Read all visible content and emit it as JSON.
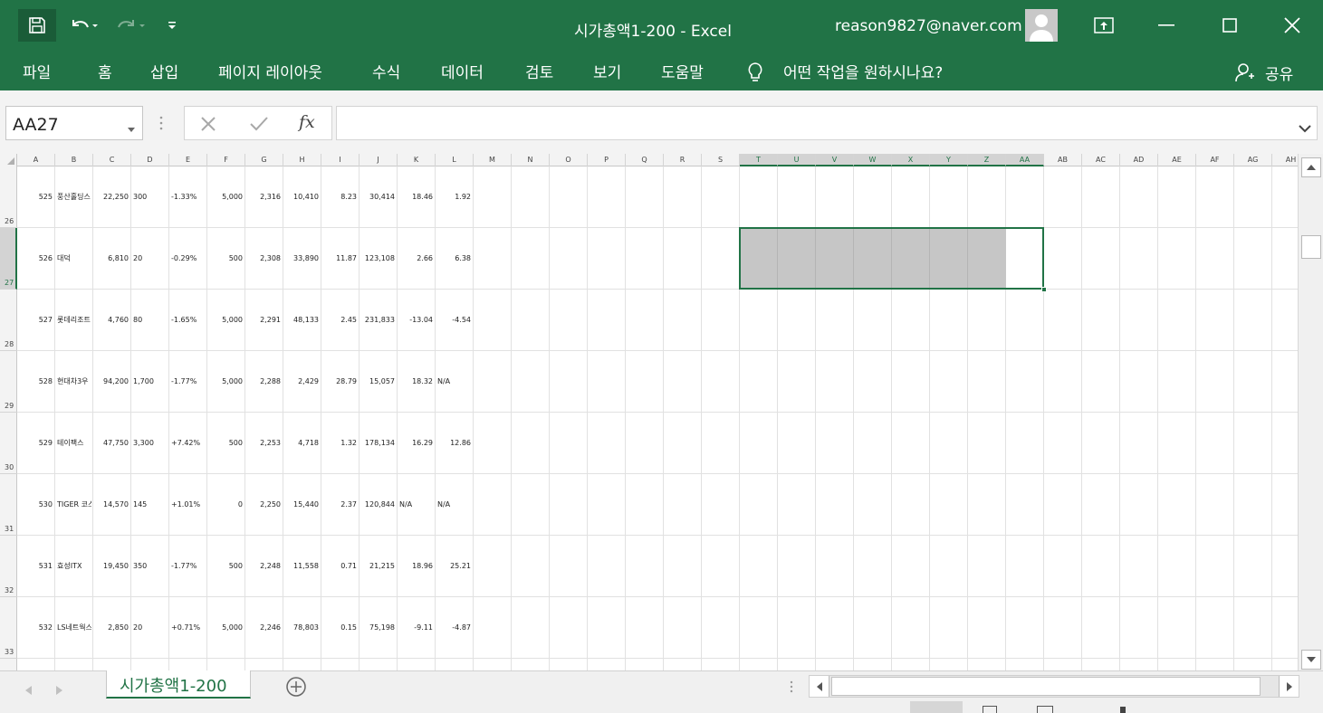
{
  "window": {
    "title": "시가총액1-200  -  Excel",
    "account": "reason9827@naver.com"
  },
  "ribbon": {
    "tabs": [
      "파일",
      "홈",
      "삽입",
      "페이지 레이아웃",
      "수식",
      "데이터",
      "검토",
      "보기",
      "도움말"
    ],
    "tell_me": "어떤 작업을 원하시나요?",
    "share": "공유"
  },
  "formula_bar": {
    "name_box": "AA27",
    "fx": "fx",
    "formula": ""
  },
  "sheet": {
    "columns": [
      "A",
      "B",
      "C",
      "D",
      "E",
      "F",
      "G",
      "H",
      "I",
      "J",
      "K",
      "L",
      "M",
      "N",
      "O",
      "P",
      "Q",
      "R",
      "S",
      "T",
      "U",
      "V",
      "W",
      "X",
      "Y",
      "Z",
      "AA",
      "AB",
      "AC",
      "AD",
      "AE",
      "AF",
      "AG",
      "AH"
    ],
    "selected_columns": [
      "T",
      "U",
      "V",
      "W",
      "X",
      "Y",
      "Z",
      "AA"
    ],
    "selected_row": "27",
    "rows": [
      {
        "num": "26",
        "cells": [
          "525",
          "풍산홀딩스",
          "22,250",
          "300",
          "-1.33%",
          "5,000",
          "2,316",
          "10,410",
          "8.23",
          "30,414",
          "18.46",
          "1.92"
        ]
      },
      {
        "num": "27",
        "cells": [
          "526",
          "대덕",
          "6,810",
          "20",
          "-0.29%",
          "500",
          "2,308",
          "33,890",
          "11.87",
          "123,108",
          "2.66",
          "6.38"
        ]
      },
      {
        "num": "28",
        "cells": [
          "527",
          "롯데리조트",
          "4,760",
          "80",
          "-1.65%",
          "5,000",
          "2,291",
          "48,133",
          "2.45",
          "231,833",
          "-13.04",
          "-4.54"
        ]
      },
      {
        "num": "29",
        "cells": [
          "528",
          "현대차3우",
          "94,200",
          "1,700",
          "-1.77%",
          "5,000",
          "2,288",
          "2,429",
          "28.79",
          "15,057",
          "18.32",
          "N/A"
        ]
      },
      {
        "num": "30",
        "cells": [
          "529",
          "테이팩스",
          "47,750",
          "3,300",
          "+7.42%",
          "500",
          "2,253",
          "4,718",
          "1.32",
          "178,134",
          "16.29",
          "12.86"
        ]
      },
      {
        "num": "31",
        "cells": [
          "530",
          "TIGER 코스",
          "14,570",
          "145",
          "+1.01%",
          "0",
          "2,250",
          "15,440",
          "2.37",
          "120,844",
          "N/A",
          "N/A"
        ]
      },
      {
        "num": "32",
        "cells": [
          "531",
          "효성ITX",
          "19,450",
          "350",
          "-1.77%",
          "500",
          "2,248",
          "11,558",
          "0.71",
          "21,215",
          "18.96",
          "25.21"
        ]
      },
      {
        "num": "33",
        "cells": [
          "532",
          "LS네트웍스",
          "2,850",
          "20",
          "+0.71%",
          "5,000",
          "2,246",
          "78,803",
          "0.15",
          "75,198",
          "-9.11",
          "-4.87"
        ]
      }
    ],
    "tab_name": "시가총액1-200"
  },
  "colors": {
    "accent": "#217346",
    "selection_fill": "#c6c6c6"
  }
}
